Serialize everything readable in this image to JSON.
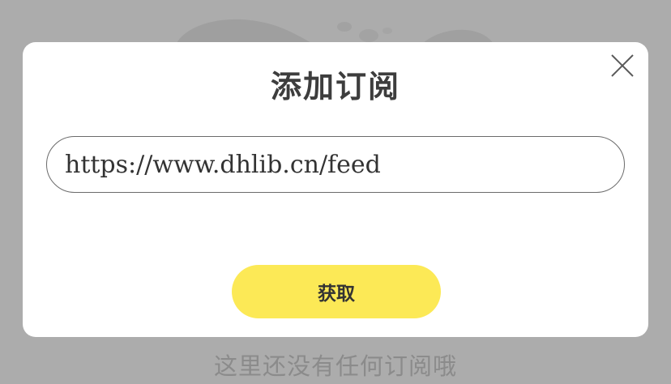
{
  "dialog": {
    "title": "添加订阅",
    "url_value": "https://www.dhlib.cn/feed",
    "fetch_label": "获取",
    "close_icon": "close-icon"
  },
  "background": {
    "empty_message": "这里还没有任何订阅哦"
  },
  "colors": {
    "overlay": "#acacac",
    "dialog_bg": "#ffffff",
    "button_accent": "#fce956",
    "title_text": "#3d3d3d",
    "muted_text": "#8b8b8b"
  }
}
